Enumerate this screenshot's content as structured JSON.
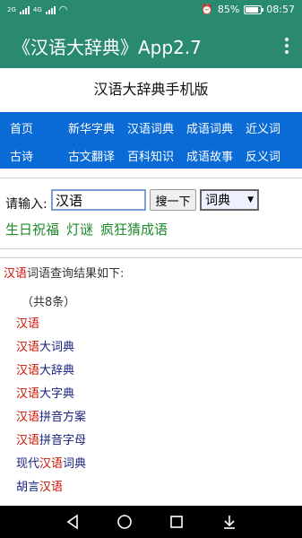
{
  "status": {
    "left_text": "2G",
    "left_text2": "4G",
    "battery": "85%",
    "battery_level": 0.85,
    "time": "08:57"
  },
  "app": {
    "title": "《汉语大辞典》App2.7"
  },
  "site_title": "汉语大辞典手机版",
  "nav": {
    "row1": [
      "首页",
      "新华字典",
      "汉语词典",
      "成语词典",
      "近义词"
    ],
    "row2": [
      "古诗",
      "古文翻译",
      "百科知识",
      "成语故事",
      "反义词"
    ]
  },
  "search": {
    "label": "请输入:",
    "value": "汉语",
    "button": "搜一下",
    "selected": "词典",
    "links": [
      "生日祝福",
      "灯谜",
      "疯狂猜成语"
    ]
  },
  "results": {
    "header_keyword": "汉语",
    "header_rest": "词语查询结果如下:",
    "count": "（共8条）",
    "items": [
      {
        "pre": "",
        "kw": "汉语",
        "post": ""
      },
      {
        "pre": "",
        "kw": "汉语",
        "post": "大词典"
      },
      {
        "pre": "",
        "kw": "汉语",
        "post": "大辞典"
      },
      {
        "pre": "",
        "kw": "汉语",
        "post": "大字典"
      },
      {
        "pre": "",
        "kw": "汉语",
        "post": "拼音方案"
      },
      {
        "pre": "",
        "kw": "汉语",
        "post": "拼音字母"
      },
      {
        "pre": "现代",
        "kw": "汉语",
        "post": "词典"
      },
      {
        "pre": "胡言",
        "kw": "汉语",
        "post": ""
      }
    ]
  },
  "colors": {
    "app_bar": "#2a8a70",
    "nav": "#0b6bd6",
    "link_green": "#1f8a2a",
    "keyword_red": "#cc1100",
    "result_blue": "#1a237e"
  }
}
